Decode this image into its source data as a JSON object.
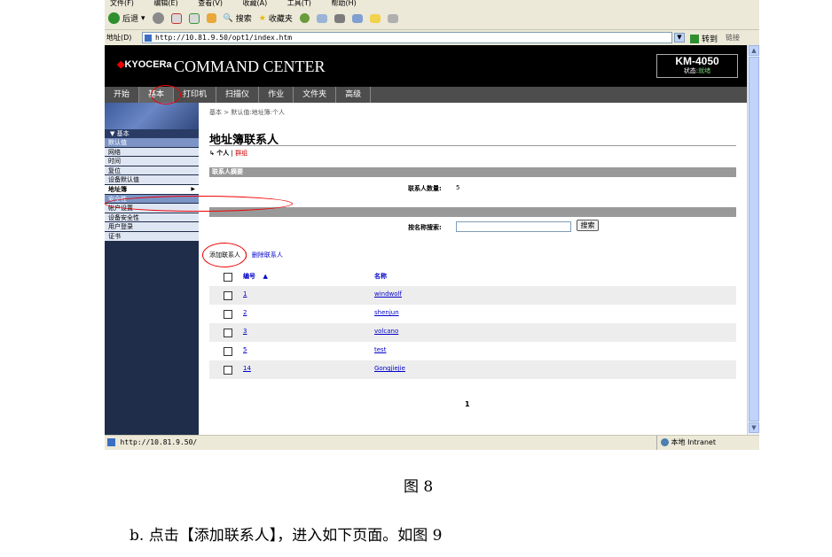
{
  "window": {
    "menu": [
      "文件(F)",
      "编辑(E)",
      "查看(V)",
      "收藏(A)",
      "工具(T)",
      "帮助(H)"
    ],
    "toolbar": {
      "back": "后退",
      "search": "搜索",
      "favorites": "收藏夹"
    },
    "address_label": "地址(D)",
    "address_url": "http://10.81.9.50/opt1/index.htm",
    "go_label": "转到",
    "links_label": "链接",
    "status_left": "http://10.81.9.50/",
    "status_right": "本地 Intranet"
  },
  "header": {
    "brand": "KYOCERa",
    "title": "COMMAND CENTER",
    "model": "KM-4050",
    "status_label": "状态:",
    "status_value": "就绪"
  },
  "nav": [
    "开始",
    "基本",
    "打印机",
    "扫描仪",
    "作业",
    "文件夹",
    "高级"
  ],
  "nav_active": "基本",
  "sidebar": {
    "section_title": "▼ 基本",
    "items": [
      {
        "label": "默认值",
        "style": "sec"
      },
      {
        "label": "网络",
        "style": "norm"
      },
      {
        "label": "时间",
        "style": "norm"
      },
      {
        "label": "复位",
        "style": "norm"
      },
      {
        "label": "设备默认值",
        "style": "norm"
      },
      {
        "label": "地址簿",
        "style": "sel"
      },
      {
        "label": "安全性",
        "style": "sec"
      },
      {
        "label": "帐户设置",
        "style": "norm"
      },
      {
        "label": "设备安全性",
        "style": "norm"
      },
      {
        "label": "用户登录",
        "style": "norm"
      },
      {
        "label": "证书",
        "style": "norm"
      }
    ],
    "flyout": [
      "个人",
      "群组"
    ]
  },
  "content": {
    "breadcrumb": "基本 > 默认值:地址簿:个人",
    "title": "地址簿联系人",
    "tab_current": "↳ 个人",
    "tab_sep": "|",
    "tab_other": "群组",
    "summary_header": "联系人摘要",
    "count_label": "联系人数量:",
    "count_value": "5",
    "search_label": "按名称搜索:",
    "search_button": "搜索",
    "add_link": "添加联系人",
    "delete_link": "删除联系人",
    "col_number": "编号",
    "col_name": "名称",
    "rows": [
      {
        "number": "1",
        "name": "windwolf"
      },
      {
        "number": "2",
        "name": "shenjun"
      },
      {
        "number": "3",
        "name": "volcano"
      },
      {
        "number": "5",
        "name": "test"
      },
      {
        "number": "14",
        "name": "Gongjiejie"
      }
    ],
    "page": "1"
  },
  "document": {
    "caption": "图 8",
    "instruction": "b. 点击【添加联系人】，进入如下页面。如图 9"
  },
  "colors": {
    "header_bg": "#000000",
    "nav_bg": "#4d4d4d",
    "sidebar_bg": "#1f2d4a",
    "highlight": "#e00000",
    "link": "#0000cc"
  }
}
